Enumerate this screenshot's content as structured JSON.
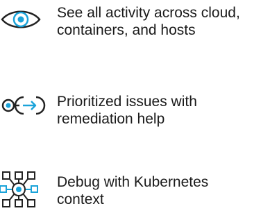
{
  "features": [
    {
      "icon": "eye-icon",
      "lines": [
        "See all activity across cloud,",
        "containers, and hosts"
      ]
    },
    {
      "icon": "remediation-arrow-icon",
      "lines": [
        "Prioritized issues with",
        "remediation help"
      ]
    },
    {
      "icon": "kubernetes-cluster-icon",
      "lines": [
        "Debug with Kubernetes",
        "context"
      ]
    }
  ],
  "colors": {
    "icon_stroke": "#222222",
    "icon_accent": "#1aa3d9",
    "text": "#1a1a1a"
  }
}
